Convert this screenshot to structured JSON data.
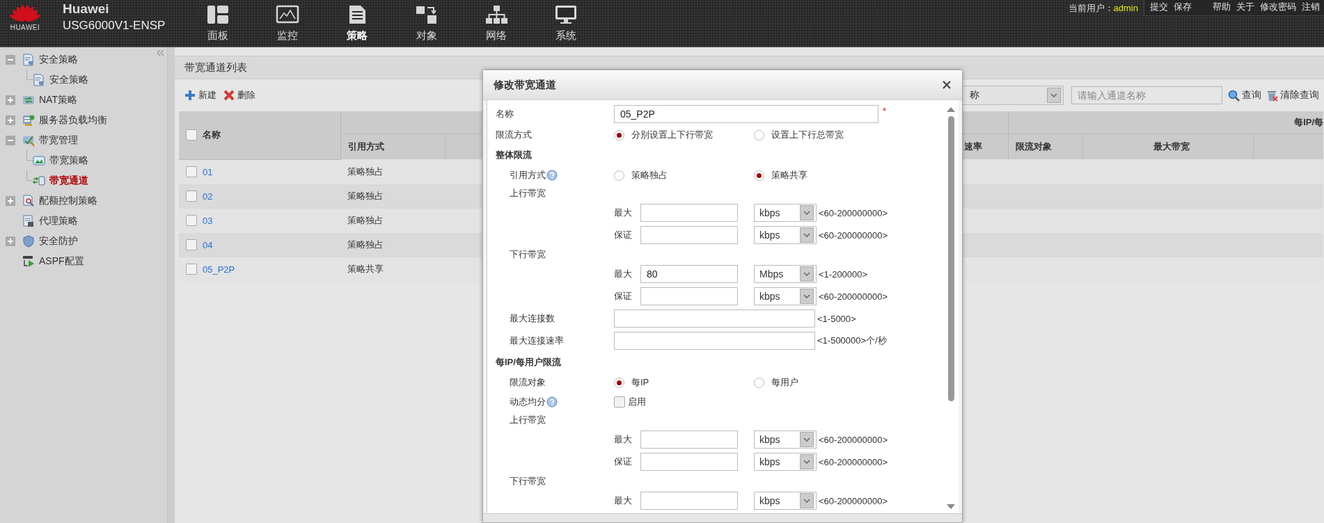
{
  "header": {
    "logo_text": "HUAWEI",
    "brand": "Huawei",
    "model": "USG6000V1-ENSP",
    "nav": [
      {
        "label": "面板",
        "kind": "dashboard",
        "selected": false
      },
      {
        "label": "监控",
        "kind": "monitor",
        "selected": false
      },
      {
        "label": "策略",
        "kind": "policy",
        "selected": true
      },
      {
        "label": "对象",
        "kind": "object",
        "selected": false
      },
      {
        "label": "网络",
        "kind": "network",
        "selected": false
      },
      {
        "label": "系统",
        "kind": "system",
        "selected": false
      }
    ],
    "user_label": "当前用户：",
    "user": "admin",
    "actions": [
      "提交",
      "保存"
    ],
    "links": [
      "帮助",
      "关于",
      "修改密码",
      "注销"
    ]
  },
  "sidebar": {
    "items": [
      {
        "label": "安全策略",
        "kind": "doc",
        "expanded": true,
        "selected": false,
        "children": [
          {
            "label": "安全策略",
            "kind": "doc",
            "selected": false
          }
        ]
      },
      {
        "label": "NAT策略",
        "kind": "nat",
        "expanded": false,
        "selected": false
      },
      {
        "label": "服务器负载均衡",
        "kind": "server",
        "expanded": false,
        "selected": false
      },
      {
        "label": "带宽管理",
        "kind": "bandwidth",
        "expanded": true,
        "selected": false,
        "children": [
          {
            "label": "带宽策略",
            "kind": "image",
            "selected": false
          },
          {
            "label": "带宽通道",
            "kind": "channel",
            "selected": true
          }
        ]
      },
      {
        "label": "配额控制策略",
        "kind": "quota",
        "expanded": false,
        "selected": false
      },
      {
        "label": "代理策略",
        "kind": "proxy",
        "selected": false
      },
      {
        "label": "安全防护",
        "kind": "shield",
        "expanded": false,
        "selected": false
      },
      {
        "label": "ASPF配置",
        "kind": "aspf",
        "selected": false
      }
    ]
  },
  "list": {
    "title": "带宽通道列表",
    "toolbar": [
      {
        "label": "新建",
        "kind": "add"
      },
      {
        "label": "删除",
        "kind": "delete"
      }
    ],
    "filter": {
      "field_value": "称",
      "placeholder": "请输入通道名称",
      "buttons": [
        {
          "label": "查询",
          "kind": "search"
        },
        {
          "label": "清除查询",
          "kind": "clear"
        }
      ]
    },
    "table": {
      "header_checked": false,
      "group_header": "每IP/每",
      "columns": [
        {
          "label": "名称"
        },
        {
          "label": "引用方式"
        },
        {
          "label": "速率"
        },
        {
          "label": "限流对象"
        },
        {
          "label": "最大带宽"
        }
      ],
      "rows": [
        {
          "checked": false,
          "name": "01",
          "reference": "策略独占"
        },
        {
          "checked": false,
          "name": "02",
          "reference": "策略独占"
        },
        {
          "checked": false,
          "name": "03",
          "reference": "策略独占"
        },
        {
          "checked": false,
          "name": "04",
          "reference": "策略独占"
        },
        {
          "checked": false,
          "name": "05_P2P",
          "reference": "策略共享"
        }
      ]
    }
  },
  "dialog": {
    "title": "修改带宽通道",
    "fields": [
      {
        "kind": "text",
        "label": "名称",
        "value": "05_P2P",
        "required_mark": "*"
      },
      {
        "kind": "radio",
        "label": "限流方式",
        "options": [
          {
            "label": "分别设置上下行带宽",
            "selected": true
          },
          {
            "label": "设置上下行总带宽",
            "selected": false
          }
        ]
      }
    ],
    "sections": [
      {
        "heading": "整体限流",
        "fields": [
          {
            "kind": "radio",
            "label": "引用方式",
            "help": true,
            "options": [
              {
                "label": "策略独占",
                "selected": false
              },
              {
                "label": "策略共享",
                "selected": true
              }
            ]
          },
          {
            "kind": "group",
            "label": "上行带宽",
            "children": [
              {
                "kind": "bandwidth",
                "label": "最大",
                "unit": "kbps",
                "range": "<60-200000000>"
              },
              {
                "kind": "bandwidth",
                "label": "保证",
                "unit": "kbps",
                "range": "<60-200000000>"
              }
            ]
          },
          {
            "kind": "group",
            "label": "下行带宽",
            "children": [
              {
                "kind": "bandwidth",
                "label": "最大",
                "value": "80",
                "unit": "Mbps",
                "range": "<1-200000>"
              },
              {
                "kind": "bandwidth",
                "label": "保证",
                "unit": "kbps",
                "range": "<60-200000000>"
              }
            ]
          },
          {
            "kind": "number",
            "label": "最大连接数",
            "range": "<1-5000>"
          },
          {
            "kind": "number",
            "label": "最大连接速率",
            "range": "<1-500000>个/秒"
          }
        ]
      },
      {
        "heading": "每IP/每用户限流",
        "fields": [
          {
            "kind": "radio",
            "label": "限流对象",
            "options": [
              {
                "label": "每IP",
                "selected": true
              },
              {
                "label": "每用户",
                "selected": false
              }
            ]
          },
          {
            "kind": "checkbox",
            "label": "动态均分",
            "help": true,
            "option": "启用",
            "checked": false
          },
          {
            "kind": "group",
            "label": "上行带宽",
            "children": [
              {
                "kind": "bandwidth",
                "label": "最大",
                "unit": "kbps",
                "range": "<60-200000000>"
              },
              {
                "kind": "bandwidth",
                "label": "保证",
                "unit": "kbps",
                "range": "<60-200000000>"
              }
            ]
          },
          {
            "kind": "group",
            "label": "下行带宽",
            "children": [
              {
                "kind": "bandwidth",
                "label": "最大",
                "unit": "kbps",
                "range": "<60-200000000>"
              }
            ]
          }
        ]
      }
    ]
  }
}
